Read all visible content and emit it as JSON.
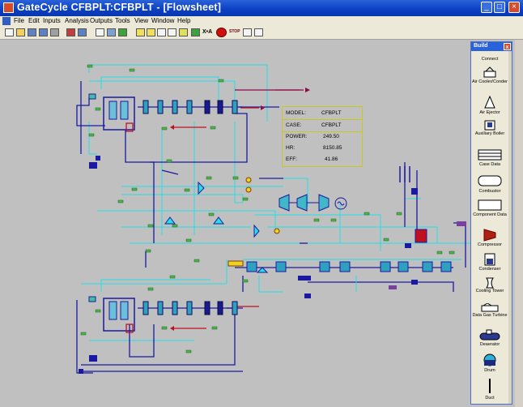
{
  "window": {
    "title": "GateCycle CFBPLT:CFBPLT - [Flowsheet]",
    "minimize": "_",
    "maximize": "□",
    "close": "×"
  },
  "menu": [
    "File",
    "Edit",
    "Inputs",
    "Analysis",
    "Outputs",
    "Tools",
    "View",
    "Window",
    "Help"
  ],
  "toolbar": {
    "xa_label": "X•A",
    "stop_label": "STOP"
  },
  "infobox": {
    "model_label": "MODEL:",
    "model_value": "CFBPLT",
    "case_label": "CASE:",
    "case_value": "CFBPLT",
    "power_label": "POWER:",
    "power_value": "249.50",
    "hr_label": "HR:",
    "hr_value": "8150.85",
    "eff_label": "EFF:",
    "eff_value": "41.86"
  },
  "build": {
    "title": "Build",
    "close": "x",
    "items": [
      "Connect",
      "Air Cooler/Conder",
      "Air Ejector",
      "Auxiliary Boiler",
      "Case Data",
      "Combustor",
      "Component Data",
      "Compressor",
      "Condenser",
      "Cooling Tower",
      "Data Gas Turbine",
      "Deaerator",
      "Drum",
      "Duct"
    ]
  },
  "colors": {
    "stream_cyan": "#22e0e8",
    "stream_navy": "#1a1aa0",
    "stream_red": "#c01020",
    "stream_magenta": "#8a0a4a",
    "stream_purple": "#7a40a0",
    "node_green": "#4ab848",
    "titlebar": "#0a3fc2"
  }
}
